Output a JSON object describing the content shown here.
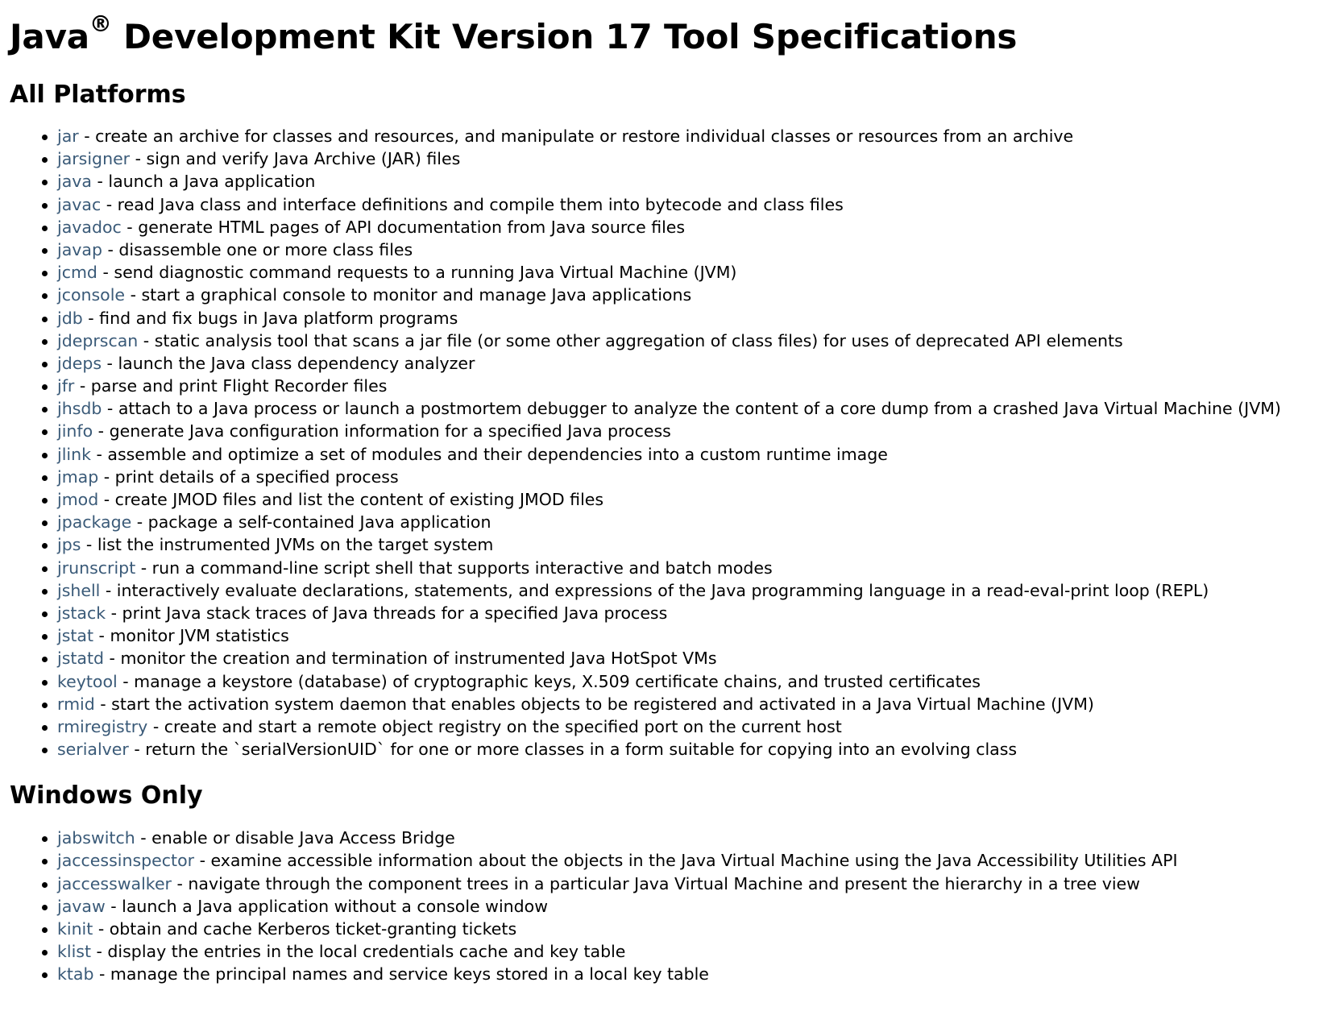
{
  "page": {
    "title_main": "Java",
    "title_reg": "®",
    "title_rest": " Development Kit Version 17 Tool Specifications"
  },
  "colors": {
    "link": "#3a5a78",
    "text": "#000000",
    "background": "#ffffff"
  },
  "sections": [
    {
      "heading": "All Platforms",
      "items": [
        {
          "name": "jar",
          "desc": " - create an archive for classes and resources, and manipulate or restore individual classes or resources from an archive"
        },
        {
          "name": "jarsigner",
          "desc": " - sign and verify Java Archive (JAR) files"
        },
        {
          "name": "java",
          "desc": " - launch a Java application"
        },
        {
          "name": "javac",
          "desc": " - read Java class and interface definitions and compile them into bytecode and class files"
        },
        {
          "name": "javadoc",
          "desc": " - generate HTML pages of API documentation from Java source files"
        },
        {
          "name": "javap",
          "desc": " - disassemble one or more class files"
        },
        {
          "name": "jcmd",
          "desc": " - send diagnostic command requests to a running Java Virtual Machine (JVM)"
        },
        {
          "name": "jconsole",
          "desc": " - start a graphical console to monitor and manage Java applications"
        },
        {
          "name": "jdb",
          "desc": " - find and fix bugs in Java platform programs"
        },
        {
          "name": "jdeprscan",
          "desc": " - static analysis tool that scans a jar file (or some other aggregation of class files) for uses of deprecated API elements"
        },
        {
          "name": "jdeps",
          "desc": " - launch the Java class dependency analyzer"
        },
        {
          "name": "jfr",
          "desc": " - parse and print Flight Recorder files"
        },
        {
          "name": "jhsdb",
          "desc": " - attach to a Java process or launch a postmortem debugger to analyze the content of a core dump from a crashed Java Virtual Machine (JVM)"
        },
        {
          "name": "jinfo",
          "desc": " - generate Java configuration information for a specified Java process"
        },
        {
          "name": "jlink",
          "desc": " - assemble and optimize a set of modules and their dependencies into a custom runtime image"
        },
        {
          "name": "jmap",
          "desc": " - print details of a specified process"
        },
        {
          "name": "jmod",
          "desc": " - create JMOD files and list the content of existing JMOD files"
        },
        {
          "name": "jpackage",
          "desc": " - package a self-contained Java application"
        },
        {
          "name": "jps",
          "desc": " - list the instrumented JVMs on the target system"
        },
        {
          "name": "jrunscript",
          "desc": " - run a command-line script shell that supports interactive and batch modes"
        },
        {
          "name": "jshell",
          "desc": " - interactively evaluate declarations, statements, and expressions of the Java programming language in a read-eval-print loop (REPL)"
        },
        {
          "name": "jstack",
          "desc": " - print Java stack traces of Java threads for a specified Java process"
        },
        {
          "name": "jstat",
          "desc": " - monitor JVM statistics"
        },
        {
          "name": "jstatd",
          "desc": " - monitor the creation and termination of instrumented Java HotSpot VMs"
        },
        {
          "name": "keytool",
          "desc": " - manage a keystore (database) of cryptographic keys, X.509 certificate chains, and trusted certificates"
        },
        {
          "name": "rmid",
          "desc": " - start the activation system daemon that enables objects to be registered and activated in a Java Virtual Machine (JVM)"
        },
        {
          "name": "rmiregistry",
          "desc": " - create and start a remote object registry on the specified port on the current host"
        },
        {
          "name": "serialver",
          "desc": " - return the `serialVersionUID` for one or more classes in a form suitable for copying into an evolving class"
        }
      ]
    },
    {
      "heading": "Windows Only",
      "items": [
        {
          "name": "jabswitch",
          "desc": " - enable or disable Java Access Bridge"
        },
        {
          "name": "jaccessinspector",
          "desc": " - examine accessible information about the objects in the Java Virtual Machine using the Java Accessibility Utilities API"
        },
        {
          "name": "jaccesswalker",
          "desc": " - navigate through the component trees in a particular Java Virtual Machine and present the hierarchy in a tree view"
        },
        {
          "name": "javaw",
          "desc": " - launch a Java application without a console window"
        },
        {
          "name": "kinit",
          "desc": " - obtain and cache Kerberos ticket-granting tickets"
        },
        {
          "name": "klist",
          "desc": " - display the entries in the local credentials cache and key table"
        },
        {
          "name": "ktab",
          "desc": " - manage the principal names and service keys stored in a local key table"
        }
      ]
    }
  ]
}
